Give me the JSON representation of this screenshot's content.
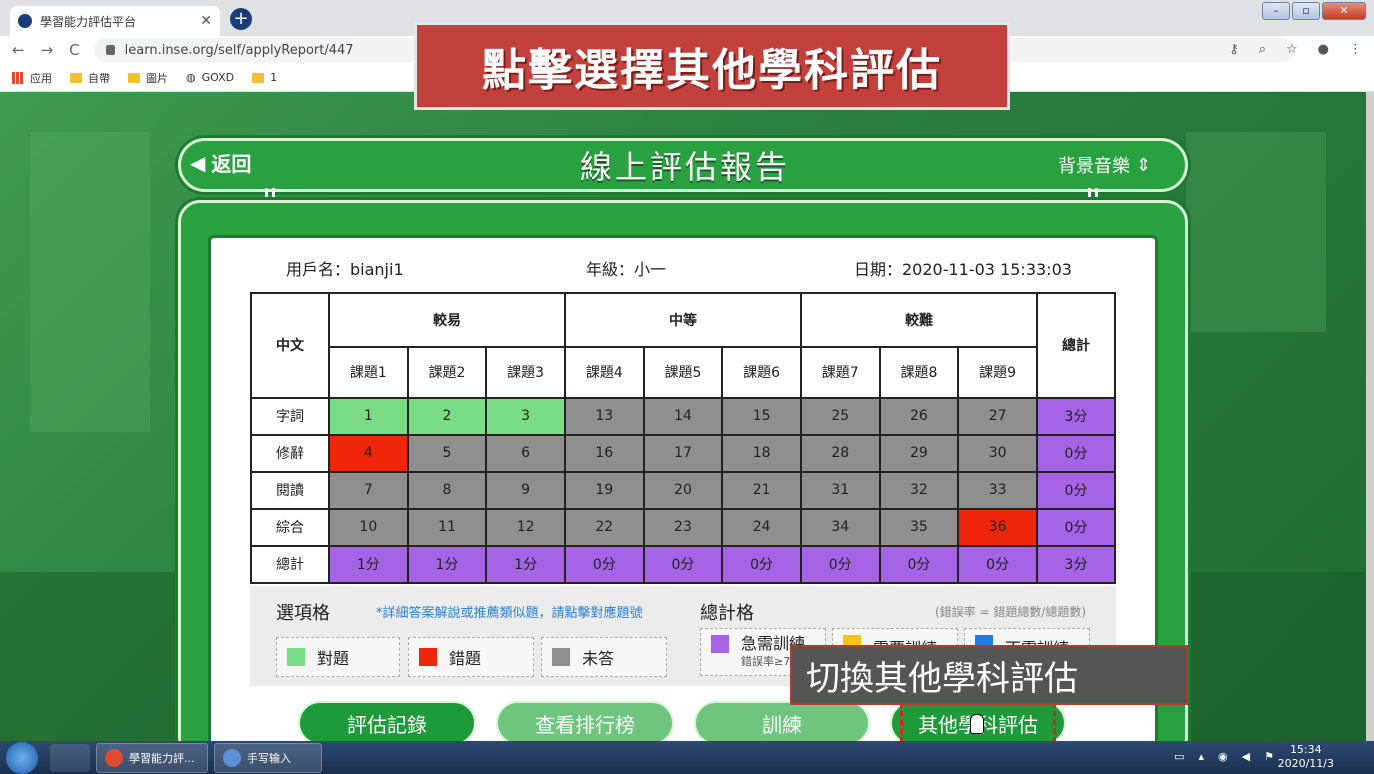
{
  "browser": {
    "tab_title": "學習能力評估平台",
    "tab_close": "✕",
    "new_tab": "+",
    "url": "learn.inse.org/self/applyReport/447",
    "nav_back": "←",
    "nav_forward": "→",
    "nav_reload": "C",
    "bookmarks": [
      "应用",
      "自帶",
      "圖片",
      "GOXD",
      "1"
    ]
  },
  "overlay": {
    "banner": "點擊選擇其他學科評估",
    "tooltip": "切換其他學科評估"
  },
  "header": {
    "back_label": "返回",
    "title": "線上評估報告",
    "music_label": "背景音樂"
  },
  "report": {
    "user_label": "用戶名：bianji1",
    "grade_label": "年級：小一",
    "date_label": "日期：2020-11-03 15:33:03",
    "corner": "中文",
    "groups": [
      "較易",
      "中等",
      "較難"
    ],
    "total_header": "總計",
    "columns": [
      "課題1",
      "課題2",
      "課題3",
      "課題4",
      "課題5",
      "課題6",
      "課題7",
      "課題8",
      "課題9"
    ],
    "rows": [
      {
        "label": "字詞",
        "cells": [
          "1",
          "2",
          "3",
          "13",
          "14",
          "15",
          "25",
          "26",
          "27"
        ],
        "states": [
          "correct",
          "correct",
          "correct",
          "unanswered",
          "unanswered",
          "unanswered",
          "unanswered",
          "unanswered",
          "unanswered"
        ],
        "total": "3分"
      },
      {
        "label": "修辭",
        "cells": [
          "4",
          "5",
          "6",
          "16",
          "17",
          "18",
          "28",
          "29",
          "30"
        ],
        "states": [
          "wrong",
          "unanswered",
          "unanswered",
          "unanswered",
          "unanswered",
          "unanswered",
          "unanswered",
          "unanswered",
          "unanswered"
        ],
        "total": "0分"
      },
      {
        "label": "閱讀",
        "cells": [
          "7",
          "8",
          "9",
          "19",
          "20",
          "21",
          "31",
          "32",
          "33"
        ],
        "states": [
          "unanswered",
          "unanswered",
          "unanswered",
          "unanswered",
          "unanswered",
          "unanswered",
          "unanswered",
          "unanswered",
          "unanswered"
        ],
        "total": "0分"
      },
      {
        "label": "綜合",
        "cells": [
          "10",
          "11",
          "12",
          "22",
          "23",
          "24",
          "34",
          "35",
          "36"
        ],
        "states": [
          "unanswered",
          "unanswered",
          "unanswered",
          "unanswered",
          "unanswered",
          "unanswered",
          "unanswered",
          "unanswered",
          "wrong"
        ],
        "total": "0分"
      }
    ],
    "total_row": {
      "label": "總計",
      "cells": [
        "1分",
        "1分",
        "1分",
        "0分",
        "0分",
        "0分",
        "0分",
        "0分",
        "0分"
      ],
      "total": "3分"
    }
  },
  "legend": {
    "options_title": "選項格",
    "options_note": "*詳細答案解說或推薦類似題，請點擊對應題號",
    "options": [
      {
        "label": "對題",
        "color": "#7bdc86"
      },
      {
        "label": "錯題",
        "color": "#f0260b"
      },
      {
        "label": "未答",
        "color": "#8f8f8f"
      }
    ],
    "totals_title": "總計格",
    "totals_note": "(錯誤率 = 錯題總數/總題數)",
    "totals": [
      {
        "label": "急需訓練",
        "sub": "錯誤率≥7",
        "color": "#a564e6"
      },
      {
        "label": "需要訓練",
        "color": "#f5c518"
      },
      {
        "label": "不需訓練",
        "color": "#1e7fe0"
      }
    ]
  },
  "buttons": {
    "records": "評估記錄",
    "ranking": "查看排行榜",
    "training": "訓練",
    "other_subject": "其他學科評估"
  },
  "colors": {
    "correct": "#7bdc86",
    "wrong": "#f0260b",
    "unanswered": "#8f8f8f",
    "total": "#a564e6"
  },
  "taskbar": {
    "apps": [
      "學習能力評...",
      "手写输入"
    ],
    "time": "15:34",
    "date": "2020/11/3"
  }
}
